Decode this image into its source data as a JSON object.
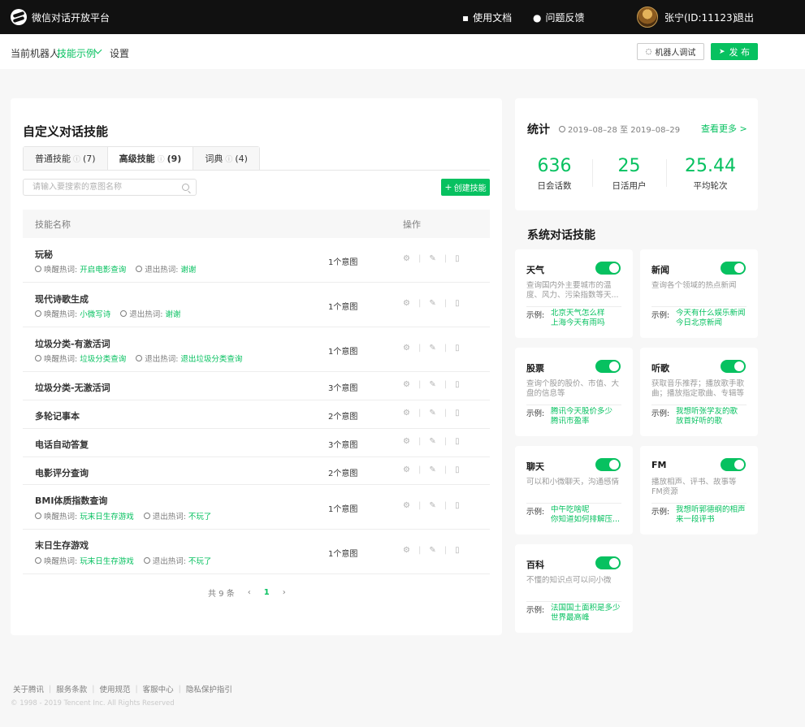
{
  "topbar": {
    "logo_text": "微信对话开放平台",
    "docs_label": "使用文档",
    "feedback_label": "问题反馈",
    "username": "张宁(ID:11123)",
    "logout_label": "退出"
  },
  "subbar": {
    "current_bot_label": "当前机器人",
    "current_bot_name": "技能示例",
    "settings_label": "设置",
    "debug_button": "机器人调试",
    "publish_button": "发 布"
  },
  "skills_panel": {
    "title": "自定义对话技能",
    "tabs": [
      {
        "label": "普通技能",
        "count": "(7)",
        "active": false
      },
      {
        "label": "高级技能",
        "count": "(9)",
        "active": true
      },
      {
        "label": "词典",
        "count": "(4)",
        "active": false
      }
    ],
    "search_placeholder": "请输入要搜索的意图名称",
    "create_button": "创建技能",
    "columns": {
      "name": "技能名称",
      "ops": "操作"
    },
    "wake_label": "唤醒热词:",
    "exit_label": "退出热词:",
    "rows": [
      {
        "name": "玩秘",
        "count": "1个意图",
        "wake": "开启电影查询",
        "exit": "谢谢"
      },
      {
        "name": "现代诗歌生成",
        "count": "1个意图",
        "wake": "小微写诗",
        "exit": "谢谢"
      },
      {
        "name": "垃圾分类-有激活词",
        "count": "1个意图",
        "wake": "垃圾分类查询",
        "exit": "退出垃圾分类查询"
      },
      {
        "name": "垃圾分类-无激活词",
        "count": "3个意图"
      },
      {
        "name": "多轮记事本",
        "count": "2个意图"
      },
      {
        "name": "电话自动答复",
        "count": "3个意图"
      },
      {
        "name": "电影评分查询",
        "count": "2个意图"
      },
      {
        "name": "BMI体质指数查询",
        "count": "1个意图",
        "wake": "玩末日生存游戏",
        "exit": "不玩了"
      },
      {
        "name": "末日生存游戏",
        "count": "1个意图",
        "wake": "玩末日生存游戏",
        "exit": "不玩了"
      }
    ],
    "pager": {
      "total": "共 9 条",
      "current_page": "1"
    }
  },
  "stats": {
    "title": "统计",
    "range": "2019–08–28 至 2019–08–29",
    "more": "查看更多 >",
    "items": [
      {
        "value": "636",
        "label": "日会话数"
      },
      {
        "value": "25",
        "label": "日活用户"
      },
      {
        "value": "25.44",
        "label": "平均轮次"
      }
    ]
  },
  "system_skills": {
    "title": "系统对话技能",
    "example_label": "示例:",
    "cards": [
      {
        "name": "天气",
        "desc": "查询国内外主要城市的温度、风力、污染指数等天...",
        "ex1": "北京天气怎么样",
        "ex2": "上海今天有雨吗",
        "enabled": true
      },
      {
        "name": "新闻",
        "desc": "查询各个领域的热点新闻",
        "ex1": "今天有什么娱乐新闻",
        "ex2": "今日北京新闻",
        "enabled": true
      },
      {
        "name": "股票",
        "desc": "查询个股的股价、市值、大盘的信息等",
        "ex1": "腾讯今天股价多少",
        "ex2": "腾讯市盈率",
        "enabled": true
      },
      {
        "name": "听歌",
        "desc": "获取音乐推荐；播放歌手歌曲；播放指定歌曲、专辑等",
        "ex1": "我想听张学友的歌",
        "ex2": "放首好听的歌",
        "enabled": true
      },
      {
        "name": "聊天",
        "desc": "可以和小微聊天，沟通感情",
        "ex1": "中午吃啥呢",
        "ex2": "你知道如何排解压...",
        "enabled": true
      },
      {
        "name": "FM",
        "desc": "播放相声、评书、故事等FM资源",
        "ex1": "我想听郭德纲的相声",
        "ex2": "来一段评书",
        "enabled": true
      },
      {
        "name": "百科",
        "desc": "不懂的知识点可以问小微",
        "ex1": "法国国土面积是多少",
        "ex2": "世界最高峰",
        "enabled": true
      }
    ]
  },
  "footer": {
    "links": [
      "关于腾讯",
      "服务条款",
      "使用规范",
      "客服中心",
      "隐私保护指引"
    ],
    "copyright": "© 1998 - 2019 Tencent Inc. All Rights Reserved"
  },
  "colors": {
    "accent": "#07c160",
    "topbar": "#111111",
    "background": "#f7f7f7"
  }
}
